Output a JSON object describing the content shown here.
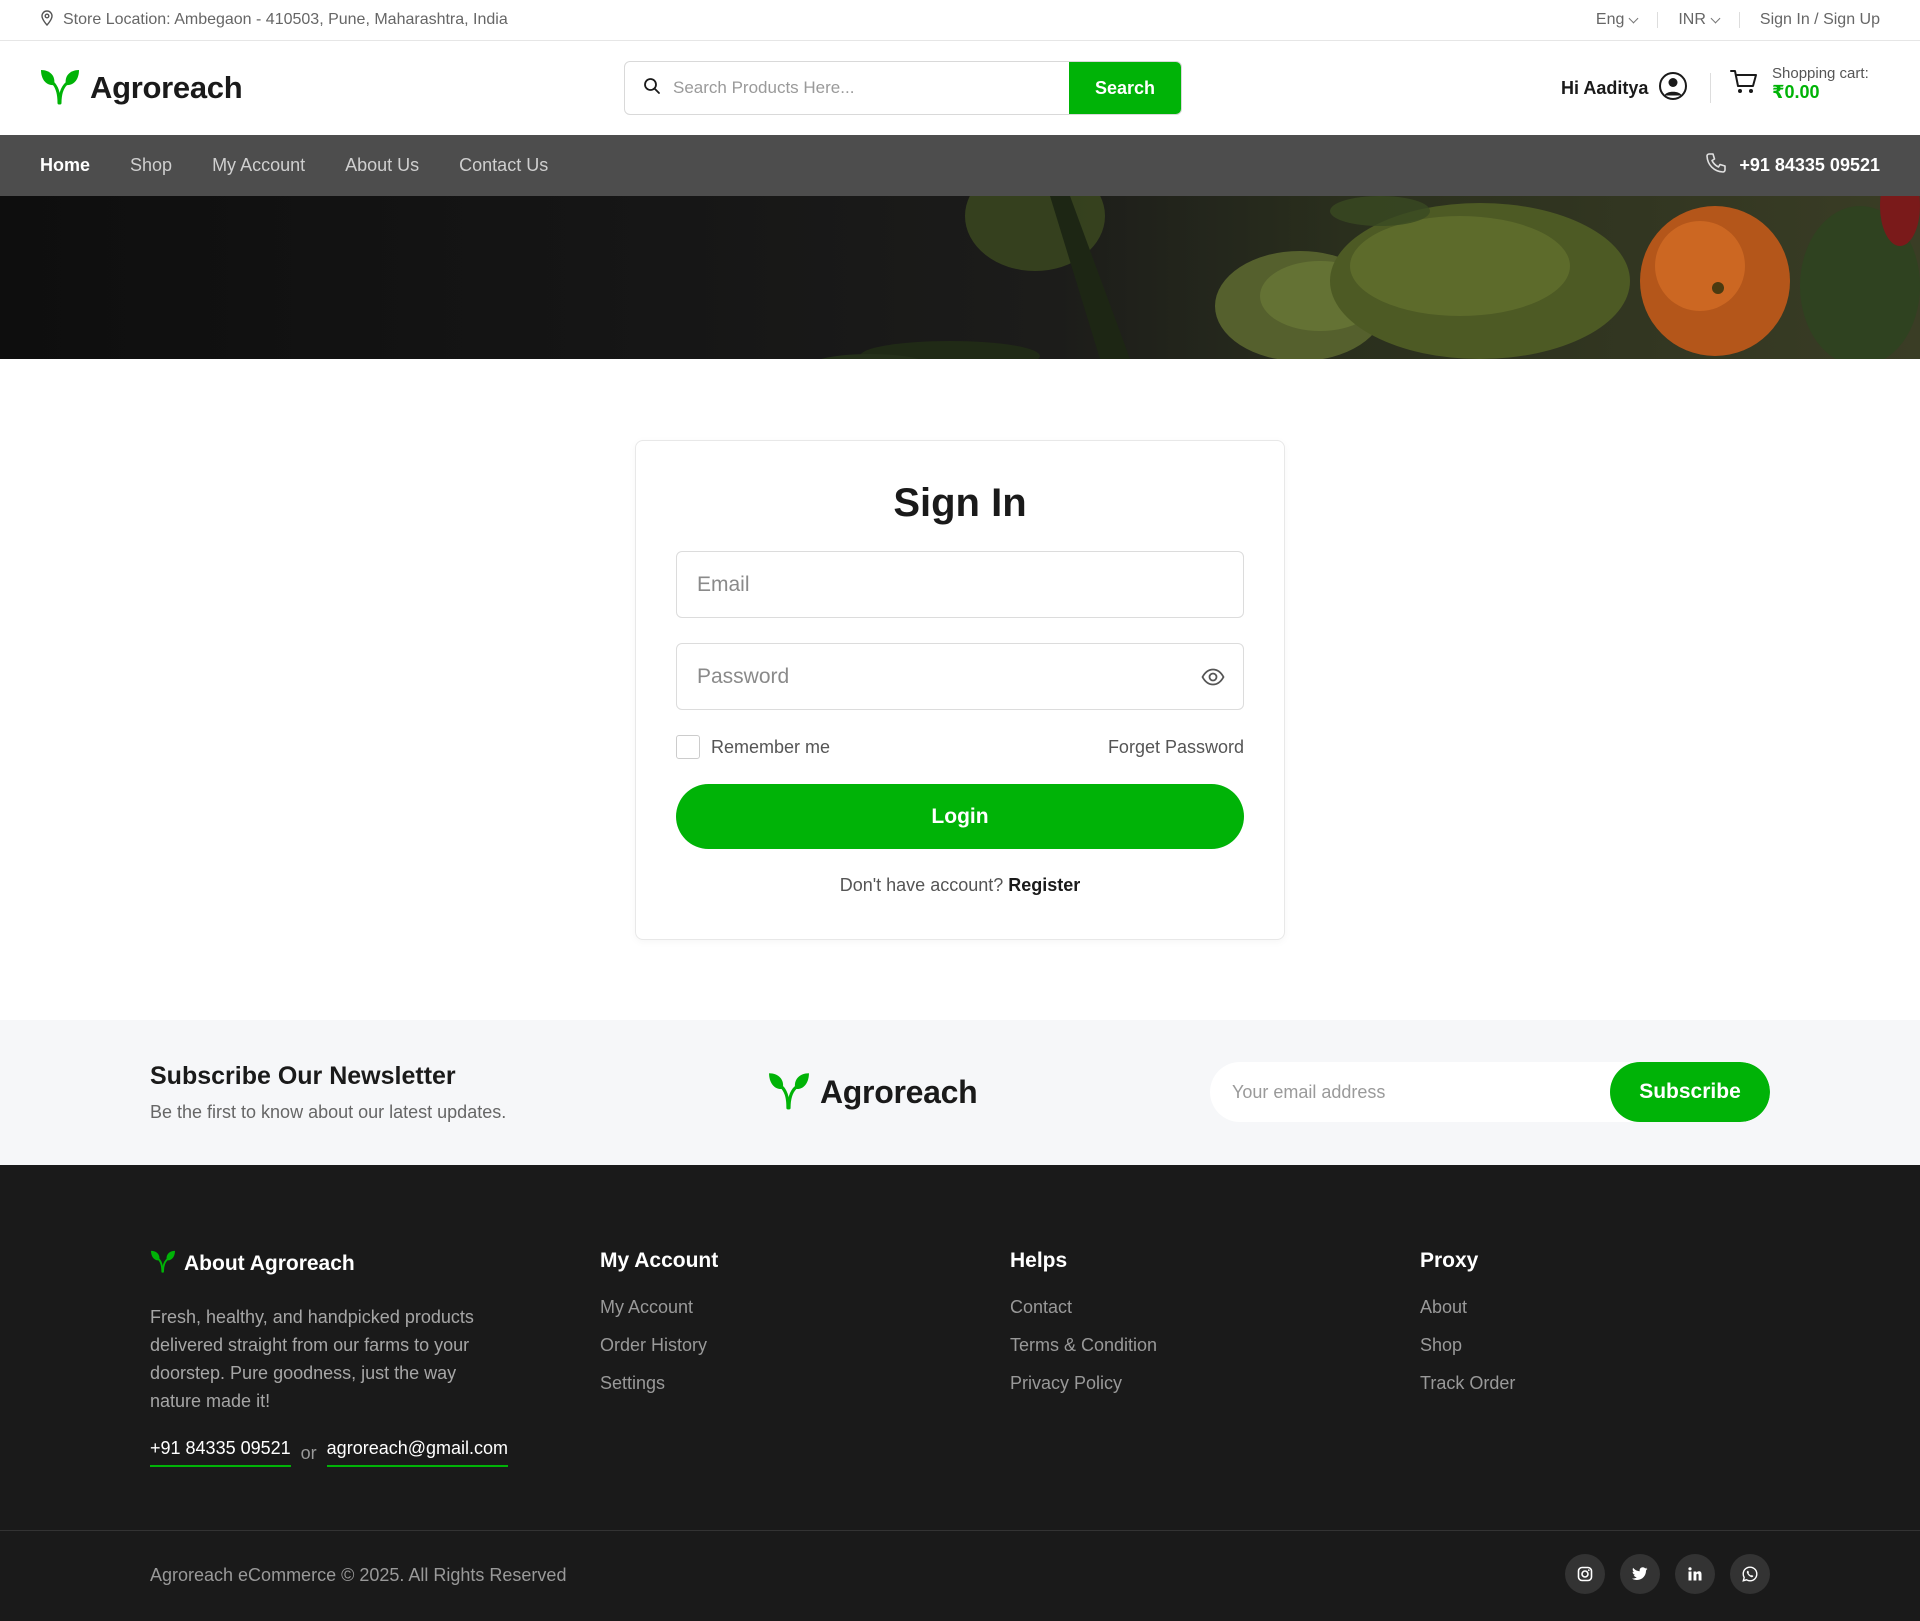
{
  "colors": {
    "accent": "#00b307",
    "nav_bg": "#4d4d4d",
    "footer_bg": "#1a1a1a",
    "newsletter_bg": "#f6f7f9"
  },
  "topbar": {
    "location": "Store Location: Ambegaon - 410503, Pune, Maharashtra, India",
    "language": "Eng",
    "currency": "INR",
    "auth": "Sign In / Sign Up"
  },
  "header": {
    "brand": "Agroreach",
    "search_placeholder": "Search Products Here...",
    "search_button": "Search",
    "greeting": "Hi Aaditya",
    "cart_label": "Shopping cart:",
    "cart_amount": "₹0.00"
  },
  "nav": {
    "items": [
      "Home",
      "Shop",
      "My Account",
      "About Us",
      "Contact Us"
    ],
    "active": "Home",
    "phone": "+91 84335 09521"
  },
  "signin": {
    "title": "Sign In",
    "email_placeholder": "Email",
    "password_placeholder": "Password",
    "remember": "Remember me",
    "forget": "Forget Password",
    "login": "Login",
    "no_account": "Don't have account?",
    "register": "Register"
  },
  "newsletter": {
    "title": "Subscribe Our Newsletter",
    "subtitle": "Be the first to know about our latest updates.",
    "brand": "Agroreach",
    "placeholder": "Your email address",
    "button": "Subscribe"
  },
  "footer": {
    "about_title": "About Agroreach",
    "about_text": "Fresh, healthy, and handpicked products delivered straight from our farms to your doorstep. Pure goodness, just the way nature made it!",
    "phone": "+91 84335 09521",
    "or": "or",
    "email": "agroreach@gmail.com",
    "account": {
      "title": "My Account",
      "links": [
        "My Account",
        "Order History",
        "Settings"
      ]
    },
    "helps": {
      "title": "Helps",
      "links": [
        "Contact",
        "Terms & Condition",
        "Privacy Policy"
      ]
    },
    "proxy": {
      "title": "Proxy",
      "links": [
        "About",
        "Shop",
        "Track Order"
      ]
    },
    "copyright": "Agroreach eCommerce © 2025. All Rights Reserved",
    "social": [
      "instagram-icon",
      "twitter-icon",
      "linkedin-icon",
      "whatsapp-icon"
    ]
  }
}
